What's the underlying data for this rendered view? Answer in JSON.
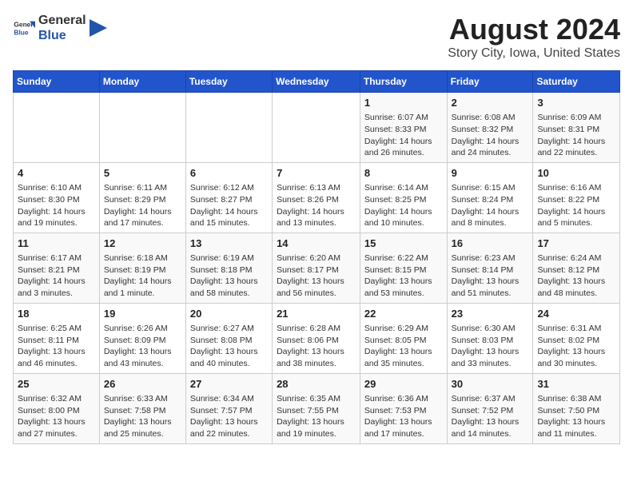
{
  "header": {
    "logo_general": "General",
    "logo_blue": "Blue",
    "month_title": "August 2024",
    "location": "Story City, Iowa, United States"
  },
  "weekdays": [
    "Sunday",
    "Monday",
    "Tuesday",
    "Wednesday",
    "Thursday",
    "Friday",
    "Saturday"
  ],
  "weeks": [
    [
      {
        "day": "",
        "data": ""
      },
      {
        "day": "",
        "data": ""
      },
      {
        "day": "",
        "data": ""
      },
      {
        "day": "",
        "data": ""
      },
      {
        "day": "1",
        "data": "Sunrise: 6:07 AM\nSunset: 8:33 PM\nDaylight: 14 hours and 26 minutes."
      },
      {
        "day": "2",
        "data": "Sunrise: 6:08 AM\nSunset: 8:32 PM\nDaylight: 14 hours and 24 minutes."
      },
      {
        "day": "3",
        "data": "Sunrise: 6:09 AM\nSunset: 8:31 PM\nDaylight: 14 hours and 22 minutes."
      }
    ],
    [
      {
        "day": "4",
        "data": "Sunrise: 6:10 AM\nSunset: 8:30 PM\nDaylight: 14 hours and 19 minutes."
      },
      {
        "day": "5",
        "data": "Sunrise: 6:11 AM\nSunset: 8:29 PM\nDaylight: 14 hours and 17 minutes."
      },
      {
        "day": "6",
        "data": "Sunrise: 6:12 AM\nSunset: 8:27 PM\nDaylight: 14 hours and 15 minutes."
      },
      {
        "day": "7",
        "data": "Sunrise: 6:13 AM\nSunset: 8:26 PM\nDaylight: 14 hours and 13 minutes."
      },
      {
        "day": "8",
        "data": "Sunrise: 6:14 AM\nSunset: 8:25 PM\nDaylight: 14 hours and 10 minutes."
      },
      {
        "day": "9",
        "data": "Sunrise: 6:15 AM\nSunset: 8:24 PM\nDaylight: 14 hours and 8 minutes."
      },
      {
        "day": "10",
        "data": "Sunrise: 6:16 AM\nSunset: 8:22 PM\nDaylight: 14 hours and 5 minutes."
      }
    ],
    [
      {
        "day": "11",
        "data": "Sunrise: 6:17 AM\nSunset: 8:21 PM\nDaylight: 14 hours and 3 minutes."
      },
      {
        "day": "12",
        "data": "Sunrise: 6:18 AM\nSunset: 8:19 PM\nDaylight: 14 hours and 1 minute."
      },
      {
        "day": "13",
        "data": "Sunrise: 6:19 AM\nSunset: 8:18 PM\nDaylight: 13 hours and 58 minutes."
      },
      {
        "day": "14",
        "data": "Sunrise: 6:20 AM\nSunset: 8:17 PM\nDaylight: 13 hours and 56 minutes."
      },
      {
        "day": "15",
        "data": "Sunrise: 6:22 AM\nSunset: 8:15 PM\nDaylight: 13 hours and 53 minutes."
      },
      {
        "day": "16",
        "data": "Sunrise: 6:23 AM\nSunset: 8:14 PM\nDaylight: 13 hours and 51 minutes."
      },
      {
        "day": "17",
        "data": "Sunrise: 6:24 AM\nSunset: 8:12 PM\nDaylight: 13 hours and 48 minutes."
      }
    ],
    [
      {
        "day": "18",
        "data": "Sunrise: 6:25 AM\nSunset: 8:11 PM\nDaylight: 13 hours and 46 minutes."
      },
      {
        "day": "19",
        "data": "Sunrise: 6:26 AM\nSunset: 8:09 PM\nDaylight: 13 hours and 43 minutes."
      },
      {
        "day": "20",
        "data": "Sunrise: 6:27 AM\nSunset: 8:08 PM\nDaylight: 13 hours and 40 minutes."
      },
      {
        "day": "21",
        "data": "Sunrise: 6:28 AM\nSunset: 8:06 PM\nDaylight: 13 hours and 38 minutes."
      },
      {
        "day": "22",
        "data": "Sunrise: 6:29 AM\nSunset: 8:05 PM\nDaylight: 13 hours and 35 minutes."
      },
      {
        "day": "23",
        "data": "Sunrise: 6:30 AM\nSunset: 8:03 PM\nDaylight: 13 hours and 33 minutes."
      },
      {
        "day": "24",
        "data": "Sunrise: 6:31 AM\nSunset: 8:02 PM\nDaylight: 13 hours and 30 minutes."
      }
    ],
    [
      {
        "day": "25",
        "data": "Sunrise: 6:32 AM\nSunset: 8:00 PM\nDaylight: 13 hours and 27 minutes."
      },
      {
        "day": "26",
        "data": "Sunrise: 6:33 AM\nSunset: 7:58 PM\nDaylight: 13 hours and 25 minutes."
      },
      {
        "day": "27",
        "data": "Sunrise: 6:34 AM\nSunset: 7:57 PM\nDaylight: 13 hours and 22 minutes."
      },
      {
        "day": "28",
        "data": "Sunrise: 6:35 AM\nSunset: 7:55 PM\nDaylight: 13 hours and 19 minutes."
      },
      {
        "day": "29",
        "data": "Sunrise: 6:36 AM\nSunset: 7:53 PM\nDaylight: 13 hours and 17 minutes."
      },
      {
        "day": "30",
        "data": "Sunrise: 6:37 AM\nSunset: 7:52 PM\nDaylight: 13 hours and 14 minutes."
      },
      {
        "day": "31",
        "data": "Sunrise: 6:38 AM\nSunset: 7:50 PM\nDaylight: 13 hours and 11 minutes."
      }
    ]
  ]
}
